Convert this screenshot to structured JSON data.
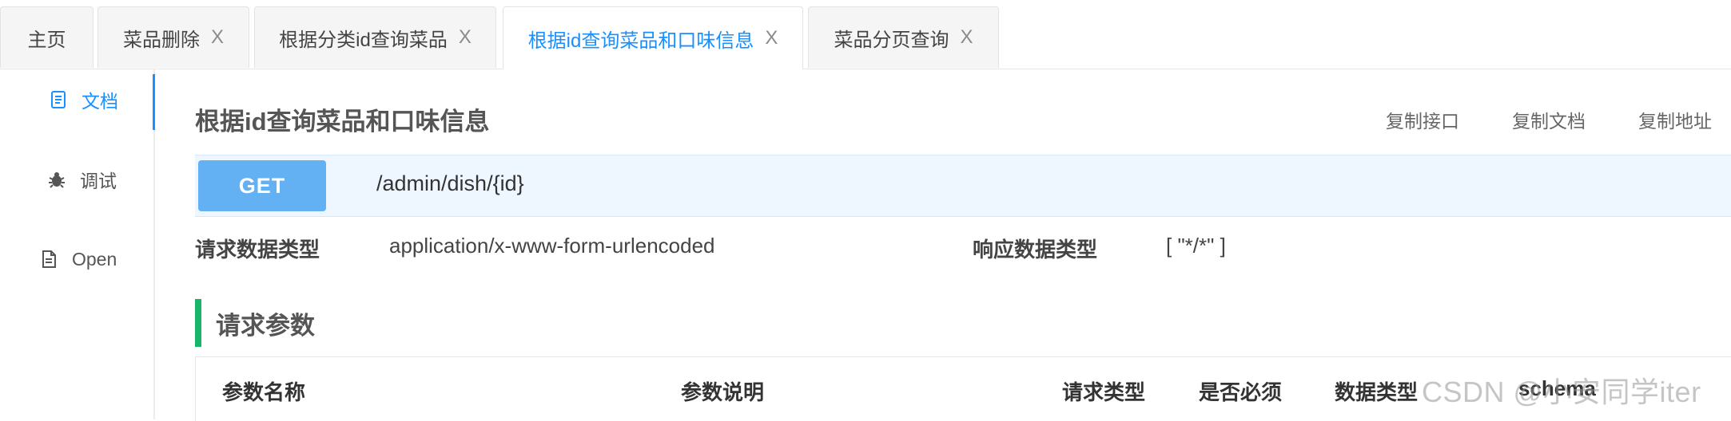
{
  "tabs": [
    {
      "label": "主页",
      "closable": false,
      "active": false
    },
    {
      "label": "菜品删除",
      "closable": true,
      "active": false
    },
    {
      "label": "根据分类id查询菜品",
      "closable": true,
      "active": false
    },
    {
      "label": "根据id查询菜品和口味信息",
      "closable": true,
      "active": true
    },
    {
      "label": "菜品分页查询",
      "closable": true,
      "active": false
    }
  ],
  "tab_close_glyph": "X",
  "sidenav": {
    "items": [
      {
        "label": "文档",
        "icon": "document-icon",
        "active": true
      },
      {
        "label": "调试",
        "icon": "bug-icon",
        "active": false
      },
      {
        "label": "Open",
        "icon": "file-icon",
        "active": false
      }
    ]
  },
  "main": {
    "title": "根据id查询菜品和口味信息",
    "actions": [
      "复制接口",
      "复制文档",
      "复制地址"
    ],
    "method": "GET",
    "path": "/admin/dish/{id}",
    "request_type_label": "请求数据类型",
    "request_type_value": "application/x-www-form-urlencoded",
    "response_type_label": "响应数据类型",
    "response_type_value": "[ \"*/*\" ]",
    "section_title": "请求参数",
    "table_headers": [
      "参数名称",
      "参数说明",
      "请求类型",
      "是否必须",
      "数据类型",
      "schema"
    ]
  },
  "watermark": "CSDN @小安同学iter",
  "colors": {
    "accent": "#1890ff",
    "method_bg": "#63b1f3",
    "url_bar_bg": "#eef6ff",
    "section_bar": "#19b56b"
  }
}
